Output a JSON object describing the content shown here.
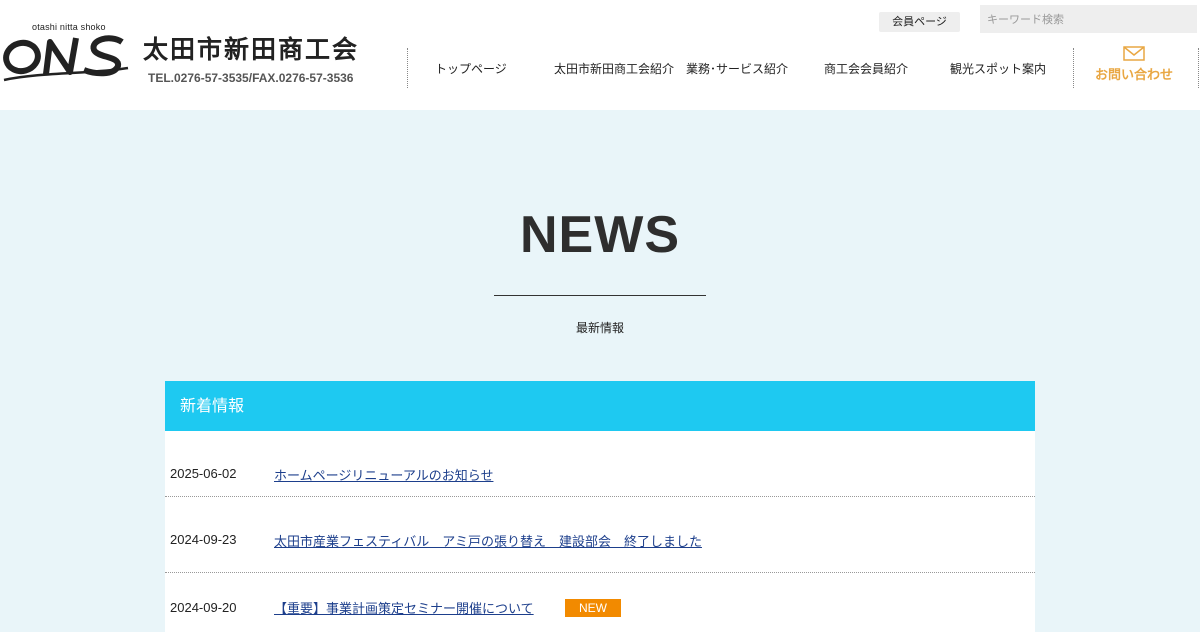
{
  "brand": {
    "logo_small_text": "otashi nitta shoko",
    "logo_mark": "ONS",
    "title": "太田市新田商工会",
    "tel": "TEL.0276-57-3535/FAX.0276-57-3536"
  },
  "header": {
    "member_label": "会員ページ",
    "search_placeholder": "キーワード検索"
  },
  "nav": {
    "items": [
      {
        "label": "トップページ"
      },
      {
        "label": "太田市新田商工会紹介"
      },
      {
        "label": "業務･サービス紹介"
      },
      {
        "label": "商工会会員紹介"
      },
      {
        "label": "観光スポット案内"
      }
    ],
    "contact_label": "お問い合わせ",
    "contact_icon": "mail-icon"
  },
  "hero": {
    "title": "NEWS",
    "subtitle": "最新情報"
  },
  "news": {
    "heading": "新着情報",
    "items": [
      {
        "date": "2025-06-02",
        "title": "ホームページリニューアルのお知らせ"
      },
      {
        "date": "2024-09-23",
        "title": "太田市産業フェスティバル　アミ戸の張り替え　建設部会　終了しました"
      },
      {
        "date": "2024-09-20",
        "title": "【重要】事業計画策定セミナー開催について",
        "badge": "NEW"
      }
    ]
  },
  "colors": {
    "accent": "#1ec9f1",
    "contact": "#e9a743",
    "badge": "#f28a00",
    "background": "#e9f5f9"
  }
}
